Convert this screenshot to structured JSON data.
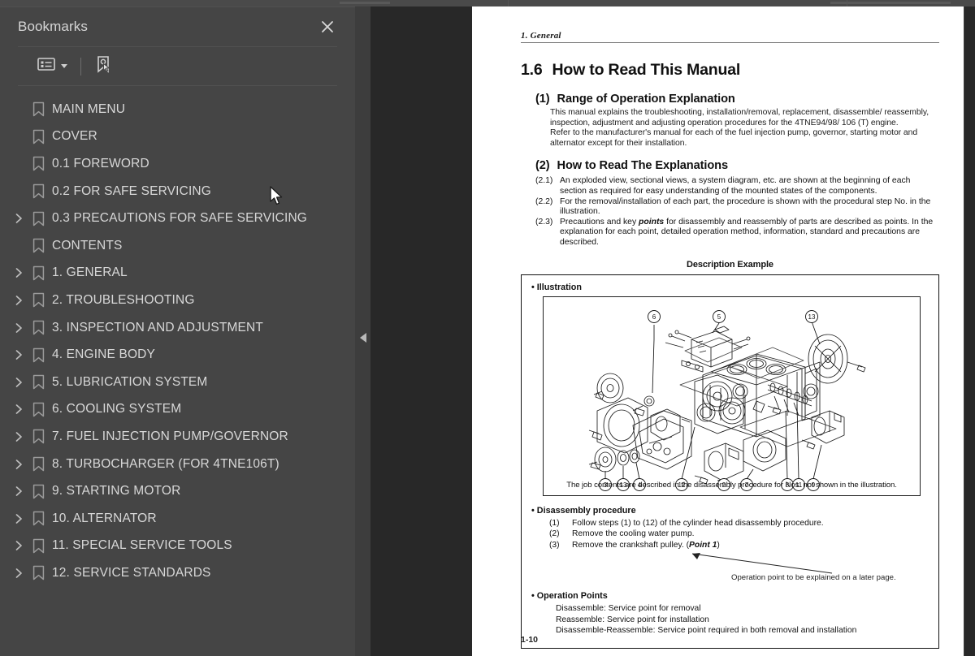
{
  "window": {
    "accent_color": "#454545",
    "viewer_bg": "#282828",
    "page_bg": "#ffffff"
  },
  "sidebar": {
    "title": "Bookmarks",
    "close_icon": "close-icon",
    "toolbar": {
      "options_label": "Bookmark Options",
      "options_icon": "list-options-icon",
      "dropdown_icon": "chevron-down-icon",
      "new_bookmark_label": "New Bookmark",
      "new_bookmark_icon": "new-bookmark-icon"
    },
    "items": [
      {
        "label": "MAIN MENU",
        "expandable": false
      },
      {
        "label": "COVER",
        "expandable": false
      },
      {
        "label": "0.1 FOREWORD",
        "expandable": false
      },
      {
        "label": "0.2 FOR SAFE SERVICING",
        "expandable": false
      },
      {
        "label": "0.3 PRECAUTIONS FOR SAFE SERVICING",
        "expandable": true
      },
      {
        "label": "CONTENTS",
        "expandable": false
      },
      {
        "label": "1. GENERAL",
        "expandable": true
      },
      {
        "label": "2. TROUBLESHOOTING",
        "expandable": true
      },
      {
        "label": "3. INSPECTION AND ADJUSTMENT",
        "expandable": true
      },
      {
        "label": "4. ENGINE BODY",
        "expandable": true
      },
      {
        "label": "5. LUBRICATION SYSTEM",
        "expandable": true
      },
      {
        "label": "6. COOLING SYSTEM",
        "expandable": true
      },
      {
        "label": "7. FUEL INJECTION PUMP/GOVERNOR",
        "expandable": true
      },
      {
        "label": "8. TURBOCHARGER (FOR 4TNE106T)",
        "expandable": true
      },
      {
        "label": "9. STARTING MOTOR",
        "expandable": true
      },
      {
        "label": "10. ALTERNATOR",
        "expandable": true
      },
      {
        "label": "11. SPECIAL SERVICE TOOLS",
        "expandable": true
      },
      {
        "label": "12. SERVICE STANDARDS",
        "expandable": true
      }
    ]
  },
  "splitter": {
    "collapse_icon": "triangle-left-icon",
    "collapse_label": "Collapse panel"
  },
  "document": {
    "running_header": "1.  General",
    "section_number": "1.6",
    "section_title": "How to Read This Manual",
    "sub1": {
      "number": "(1)",
      "title": "Range of Operation Explanation",
      "para1": "This manual explains the troubleshooting, installation/removal, replacement, disassemble/ reassembly, inspection, adjustment and adjusting operation procedures for the 4TNE94/98/ 106 (T) engine.",
      "para2": "Refer to the manufacturer's manual for each of the fuel injection pump, governor, starting motor and alternator except for their installation."
    },
    "sub2": {
      "number": "(2)",
      "title": "How to Read The Explanations",
      "items": [
        {
          "n": "(2.1)",
          "text": "An exploded view, sectional views, a system diagram, etc. are shown at the beginning of each section as required for easy understanding of the mounted states of the components."
        },
        {
          "n": "(2.2)",
          "text": "For the removal/installation of each part, the procedure is shown with the procedural step No. in the illustration."
        },
        {
          "n": "(2.3)",
          "text": "Precautions and key points for disassembly and reassembly of parts are described as points. In the explanation for each point, detailed operation method, information, standard and precautions are described.",
          "emphasis": "points"
        }
      ]
    },
    "description_example_title": "Description Example",
    "example_box": {
      "illustration_label": "• Illustration",
      "illustration_caption": "The job contents are described in the disassembly procedure for Nos. not shown in the illustration.",
      "illustration_callouts_top": [
        "6",
        "5",
        "13"
      ],
      "illustration_callouts_bottom": [
        "3",
        "13",
        "4",
        "12",
        "2",
        "7",
        "8",
        "11",
        "9"
      ],
      "disassembly_label": "• Disassembly procedure",
      "disassembly_steps": [
        {
          "n": "(1)",
          "text": "Follow steps (1) to (12) of the cylinder head disassembly procedure."
        },
        {
          "n": "(2)",
          "text": "Remove the cooling water pump."
        },
        {
          "n": "(3)",
          "text": "Remove the crankshaft pulley. (",
          "emphasis": "Point 1",
          "tail": ")"
        }
      ],
      "annotation": "Operation point to be explained on a later page.",
      "operation_points_label": "• Operation Points",
      "operation_points": [
        "Disassemble: Service point for removal",
        "Reassemble: Service point for installation",
        "Disassemble-Reassemble: Service point required in both removal and installation"
      ]
    },
    "page_number": "1-10"
  }
}
